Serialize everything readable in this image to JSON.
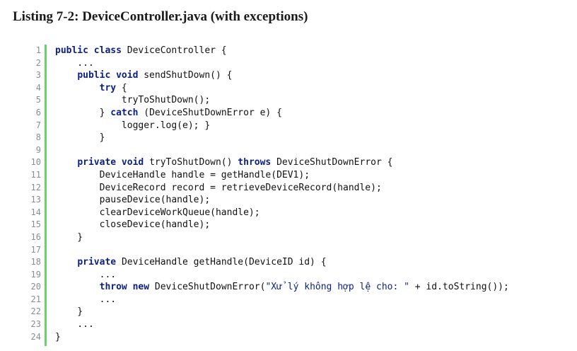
{
  "listing": {
    "label": "Listing 7-2",
    "separator": ": ",
    "name": "DeviceController.java (with exceptions)"
  },
  "code_lines": [
    {
      "n": "1",
      "tokens": [
        {
          "t": "public class ",
          "k": "kw"
        },
        {
          "t": "DeviceController {",
          "k": ""
        }
      ]
    },
    {
      "n": "2",
      "tokens": [
        {
          "t": "    ...",
          "k": ""
        }
      ]
    },
    {
      "n": "3",
      "tokens": [
        {
          "t": "    ",
          "k": ""
        },
        {
          "t": "public void ",
          "k": "kw"
        },
        {
          "t": "sendShutDown() {",
          "k": ""
        }
      ]
    },
    {
      "n": "4",
      "tokens": [
        {
          "t": "        ",
          "k": ""
        },
        {
          "t": "try",
          "k": "kw"
        },
        {
          "t": " {",
          "k": ""
        }
      ]
    },
    {
      "n": "5",
      "tokens": [
        {
          "t": "            tryToShutDown();",
          "k": ""
        }
      ]
    },
    {
      "n": "6",
      "tokens": [
        {
          "t": "        } ",
          "k": ""
        },
        {
          "t": "catch",
          "k": "kw"
        },
        {
          "t": " (DeviceShutDownError e) {",
          "k": ""
        }
      ]
    },
    {
      "n": "7",
      "tokens": [
        {
          "t": "            logger.log(e); }",
          "k": ""
        }
      ]
    },
    {
      "n": "8",
      "tokens": [
        {
          "t": "        }",
          "k": ""
        }
      ]
    },
    {
      "n": "9",
      "tokens": [
        {
          "t": "",
          "k": ""
        }
      ]
    },
    {
      "n": "10",
      "tokens": [
        {
          "t": "    ",
          "k": ""
        },
        {
          "t": "private void ",
          "k": "kw"
        },
        {
          "t": "tryToShutDown() ",
          "k": ""
        },
        {
          "t": "throws",
          "k": "kw"
        },
        {
          "t": " DeviceShutDownError {",
          "k": ""
        }
      ]
    },
    {
      "n": "11",
      "tokens": [
        {
          "t": "        DeviceHandle handle = getHandle(DEV1);",
          "k": ""
        }
      ]
    },
    {
      "n": "12",
      "tokens": [
        {
          "t": "        DeviceRecord record = retrieveDeviceRecord(handle);",
          "k": ""
        }
      ]
    },
    {
      "n": "13",
      "tokens": [
        {
          "t": "        pauseDevice(handle);",
          "k": ""
        }
      ]
    },
    {
      "n": "14",
      "tokens": [
        {
          "t": "        clearDeviceWorkQueue(handle);",
          "k": ""
        }
      ]
    },
    {
      "n": "15",
      "tokens": [
        {
          "t": "        closeDevice(handle);",
          "k": ""
        }
      ]
    },
    {
      "n": "16",
      "tokens": [
        {
          "t": "    }",
          "k": ""
        }
      ]
    },
    {
      "n": "17",
      "tokens": [
        {
          "t": "",
          "k": ""
        }
      ]
    },
    {
      "n": "18",
      "tokens": [
        {
          "t": "    ",
          "k": ""
        },
        {
          "t": "private ",
          "k": "kw"
        },
        {
          "t": "DeviceHandle getHandle(DeviceID id) {",
          "k": ""
        }
      ]
    },
    {
      "n": "19",
      "tokens": [
        {
          "t": "        ...",
          "k": ""
        }
      ]
    },
    {
      "n": "20",
      "tokens": [
        {
          "t": "        ",
          "k": ""
        },
        {
          "t": "throw new ",
          "k": "kw"
        },
        {
          "t": "DeviceShutDownError(",
          "k": ""
        },
        {
          "t": "\"Xử lý không hợp lệ cho: \"",
          "k": "str"
        },
        {
          "t": " + id.toString());",
          "k": ""
        }
      ]
    },
    {
      "n": "21",
      "tokens": [
        {
          "t": "        ...",
          "k": ""
        }
      ]
    },
    {
      "n": "22",
      "tokens": [
        {
          "t": "    }",
          "k": ""
        }
      ]
    },
    {
      "n": "23",
      "tokens": [
        {
          "t": "    ...",
          "k": ""
        }
      ]
    },
    {
      "n": "24",
      "tokens": [
        {
          "t": "}",
          "k": ""
        }
      ]
    }
  ],
  "colors": {
    "keyword": "#0b1f88",
    "gutter_rule": "#6ad06a",
    "line_number": "#8c8c8c"
  }
}
